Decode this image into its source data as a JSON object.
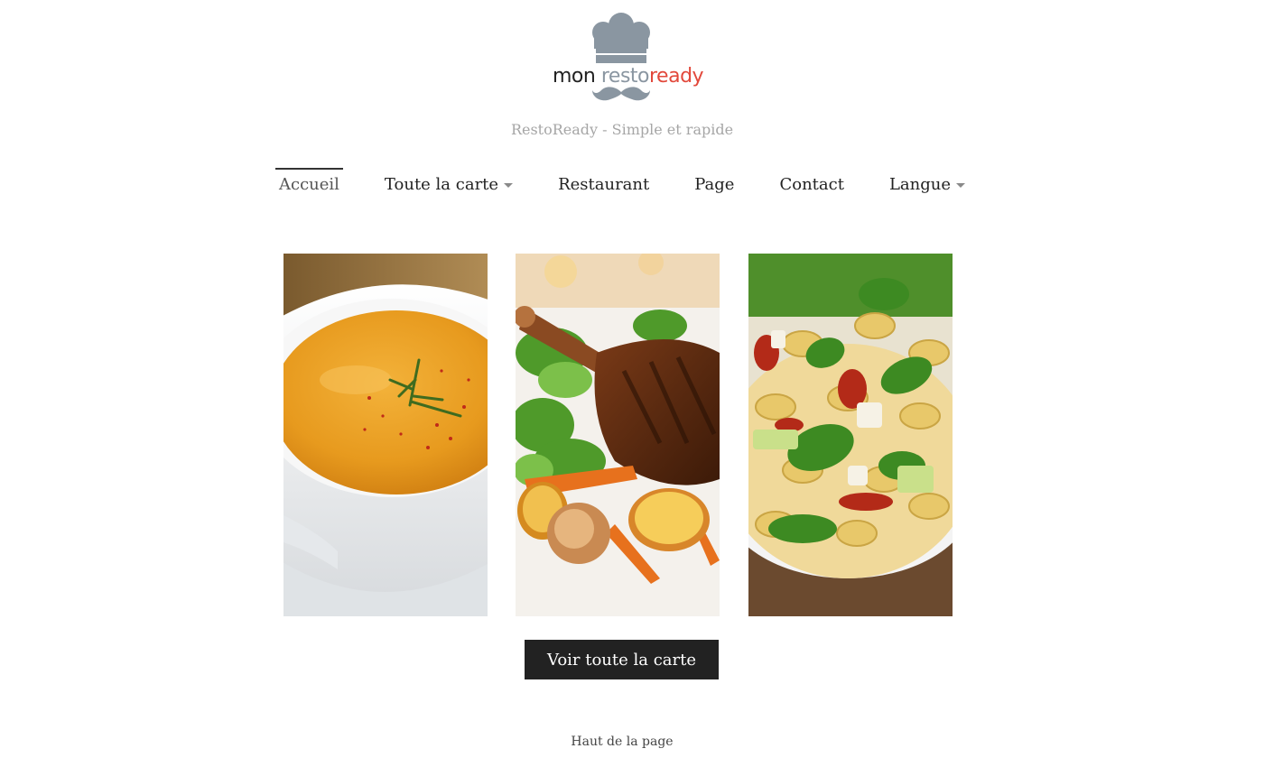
{
  "brand": {
    "logo_word_1": "mon",
    "logo_word_2": "resto",
    "logo_word_3": "ready",
    "tagline": "RestoReady - Simple et rapide",
    "colors": {
      "gray": "#8a96a1",
      "red": "#e2483b",
      "dark": "#222222"
    }
  },
  "nav": {
    "items": [
      {
        "label": "Accueil",
        "active": true
      },
      {
        "label": "Toute la carte",
        "dropdown": true
      },
      {
        "label": "Restaurant"
      },
      {
        "label": "Page"
      },
      {
        "label": "Contact"
      },
      {
        "label": "Langue",
        "dropdown": true
      }
    ]
  },
  "gallery": {
    "images": [
      {
        "name": "soup-photo",
        "subject": "pumpkin soup"
      },
      {
        "name": "lamb-photo",
        "subject": "grilled lamb chop with vegetables"
      },
      {
        "name": "pasta-salad-photo",
        "subject": "pasta salad with basil"
      }
    ]
  },
  "cta": {
    "label": "Voir toute la carte"
  },
  "footer": {
    "back_to_top": "Haut de la page"
  }
}
